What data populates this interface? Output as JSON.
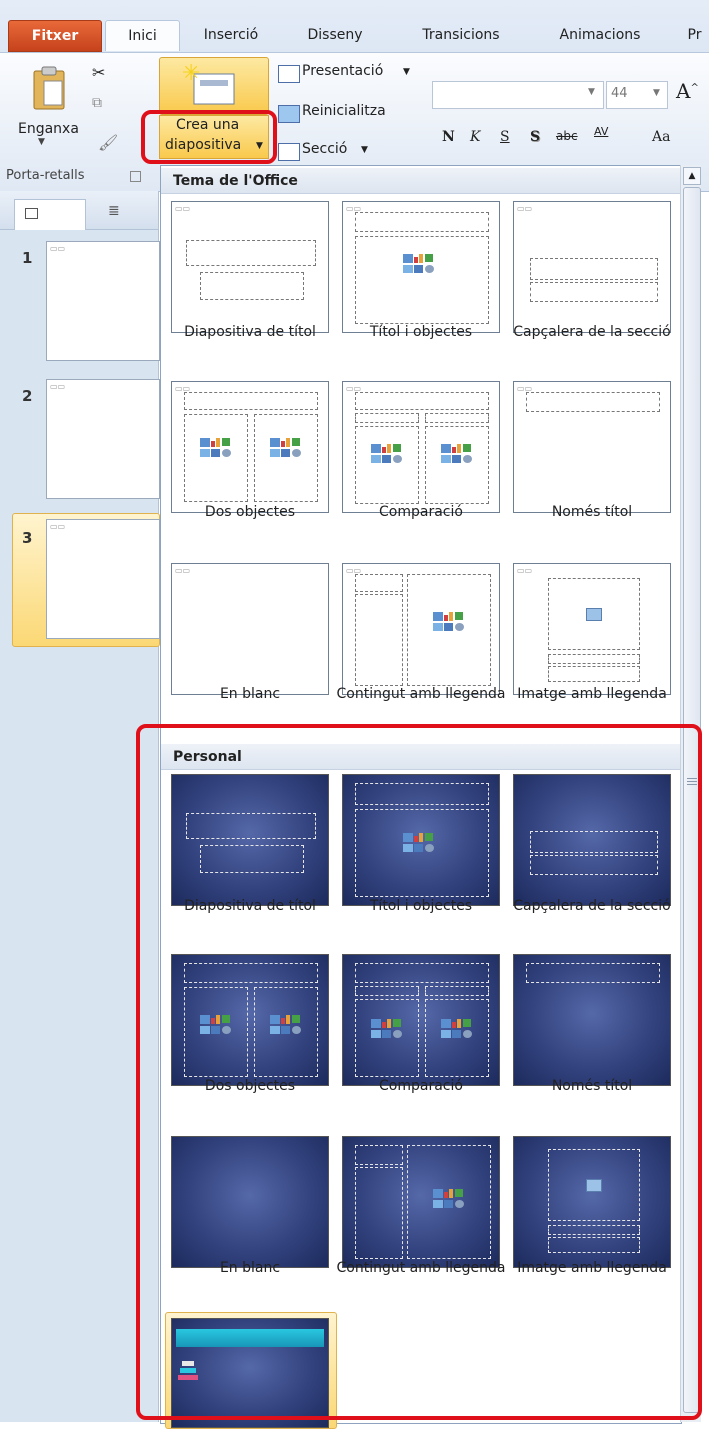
{
  "tabs": [
    "Fitxer",
    "Inici",
    "Inserció",
    "Disseny",
    "Transicions",
    "Animacions",
    "Pr"
  ],
  "ribbon": {
    "paste_label": "Enganxa",
    "new_slide_label_1": "Crea una",
    "new_slide_label_2": "diapositiva",
    "layout_label": "Presentació",
    "reset_label": "Reinicialitza",
    "section_label": "Secció",
    "font_size": "44",
    "clipboard_group": "Porta-retalls",
    "format_buttons": [
      "N",
      "K",
      "S",
      "S",
      "abc",
      "AV",
      "Aa"
    ]
  },
  "slides": [
    "1",
    "2",
    "3"
  ],
  "gallery": {
    "office_title": "Tema de l'Office",
    "personal_title": "Personal",
    "layouts": [
      "Diapositiva de títol",
      "Títol i objectes",
      "Capçalera de la secció",
      "Dos objectes",
      "Comparació",
      "Només títol",
      "En blanc",
      "Contingut amb llegenda",
      "Imatge amb llegenda"
    ]
  },
  "colors": {
    "highlight": "#e0101a",
    "file_tab": "#d0532a",
    "selected": "#fbd875"
  }
}
